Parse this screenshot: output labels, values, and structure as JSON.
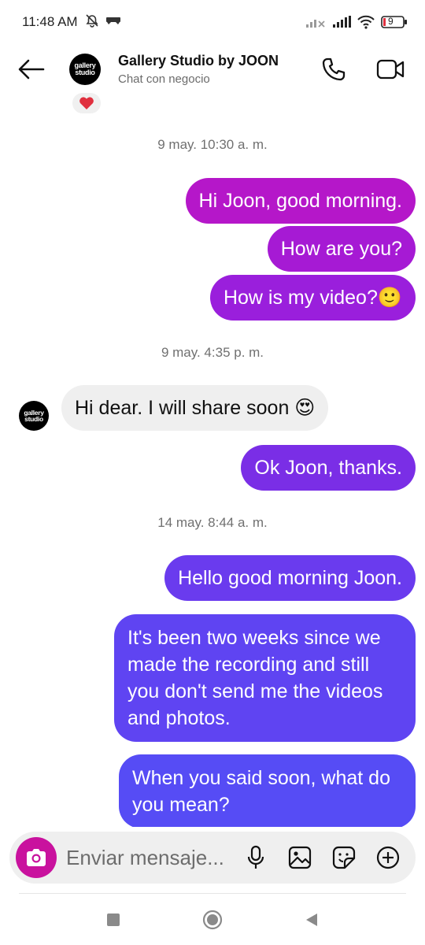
{
  "status_bar": {
    "time": "11:48 AM",
    "battery_level": "9"
  },
  "header": {
    "contact_name": "Gallery Studio by JOON",
    "subtitle": "Chat con negocio",
    "avatar_line1": "gallery",
    "avatar_line2": "studio"
  },
  "conversation": {
    "timestamps": [
      "9 may. 10:30 a. m.",
      "9 may. 4:35 p. m.",
      "14 may. 8:44 a. m."
    ],
    "messages": [
      {
        "text": "Hi Joon, good morning.",
        "direction": "outgoing",
        "color": "#b517c9"
      },
      {
        "text": "How are you?",
        "direction": "outgoing",
        "color": "#a61ad4"
      },
      {
        "text": "How is my video?🙂",
        "direction": "outgoing",
        "color": "#9a1fdc"
      },
      {
        "text": "Hi dear. I will share soon 😍",
        "direction": "incoming"
      },
      {
        "text": "Ok Joon, thanks.",
        "direction": "outgoing",
        "color": "#7a2ee6"
      },
      {
        "text": "Hello good morning Joon.",
        "direction": "outgoing",
        "color": "#6a3bee"
      },
      {
        "text": "It's been two weeks since we made the recording and still you don't send me the videos and photos.",
        "direction": "outgoing",
        "color": "#5f44f2"
      },
      {
        "text": "When you said soon, what do you mean?",
        "direction": "outgoing",
        "color": "#564cf5"
      }
    ]
  },
  "composer": {
    "placeholder": "Enviar mensaje..."
  },
  "colors": {
    "camera_button": "#c9129e",
    "reaction": "#e0303f"
  }
}
